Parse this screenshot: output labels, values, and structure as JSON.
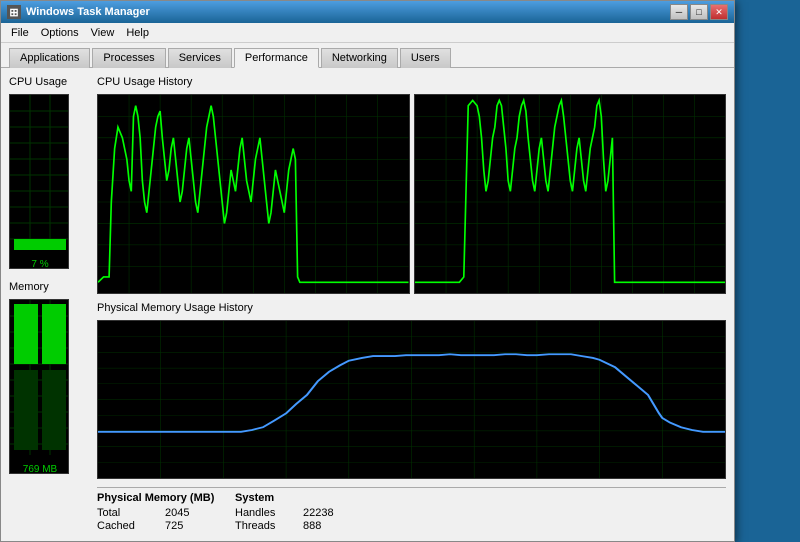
{
  "window": {
    "title": "Windows Task Manager",
    "icon": "☰"
  },
  "title_controls": {
    "minimize": "─",
    "maximize": "□",
    "close": "✕"
  },
  "menu": {
    "items": [
      "File",
      "Options",
      "View",
      "Help"
    ]
  },
  "tabs": [
    {
      "label": "Applications",
      "active": false
    },
    {
      "label": "Processes",
      "active": false
    },
    {
      "label": "Services",
      "active": false
    },
    {
      "label": "Performance",
      "active": true
    },
    {
      "label": "Networking",
      "active": false
    },
    {
      "label": "Users",
      "active": false
    }
  ],
  "left": {
    "cpu_label": "CPU Usage",
    "cpu_value": "7 %",
    "cpu_percent": 7,
    "mem_label": "Memory",
    "mem_value": "769 MB",
    "mem_percent": 38
  },
  "charts": {
    "cpu_history_label": "CPU Usage History",
    "mem_history_label": "Physical Memory Usage History"
  },
  "bottom_stats": {
    "col1_label": "Physical Memory (MB)",
    "col1_rows": [
      {
        "label": "Total",
        "value": "2045"
      },
      {
        "label": "Cached",
        "value": "725"
      }
    ],
    "col2_label": "System",
    "col2_rows": [
      {
        "label": "Handles",
        "value": "22238"
      },
      {
        "label": "Threads",
        "value": "888"
      }
    ]
  }
}
